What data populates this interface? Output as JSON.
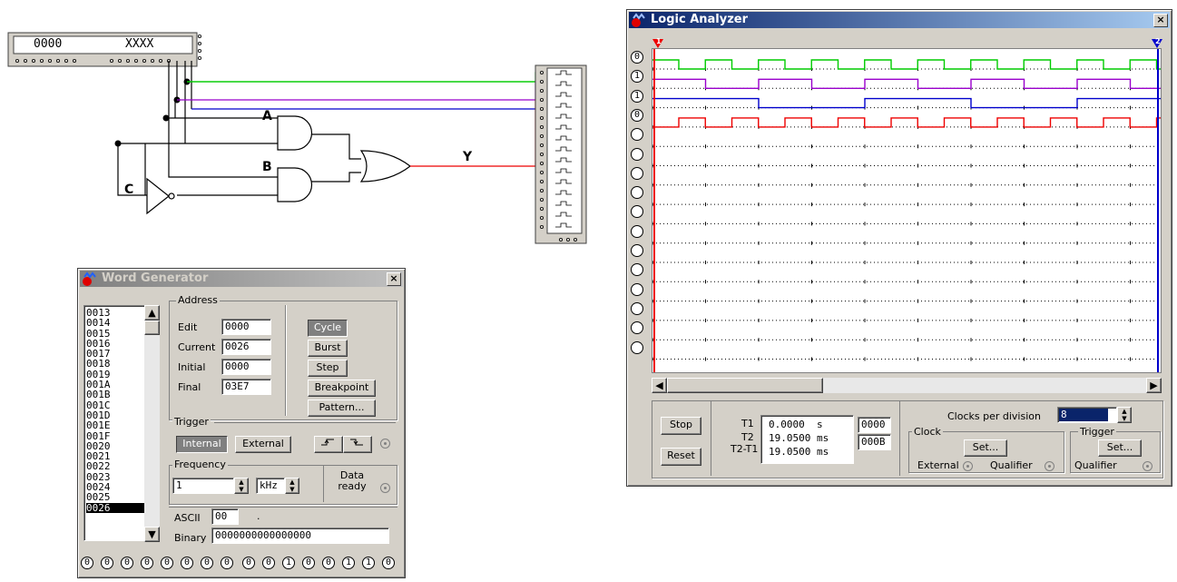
{
  "circuit": {
    "word_display": {
      "left": "0000",
      "right": "XXXX"
    },
    "labels": {
      "a": "A",
      "b": "B",
      "c": "C",
      "y": "Y"
    }
  },
  "word_generator": {
    "title": "Word Generator",
    "list": [
      "0013",
      "0014",
      "0015",
      "0016",
      "0017",
      "0018",
      "0019",
      "001A",
      "001B",
      "001C",
      "001D",
      "001E",
      "001F",
      "0020",
      "0021",
      "0022",
      "0023",
      "0024",
      "0025",
      "0026"
    ],
    "selected": "0026",
    "address": {
      "group": "Address",
      "edit_label": "Edit",
      "edit_value": "0000",
      "current_label": "Current",
      "current_value": "0026",
      "initial_label": "Initial",
      "initial_value": "0000",
      "final_label": "Final",
      "final_value": "03E7"
    },
    "buttons": {
      "cycle": "Cycle",
      "burst": "Burst",
      "step": "Step",
      "breakpoint": "Breakpoint",
      "pattern": "Pattern..."
    },
    "trigger": {
      "group": "Trigger",
      "internal": "Internal",
      "external": "External"
    },
    "frequency": {
      "group": "Frequency",
      "value": "1",
      "unit": "kHz",
      "data_ready": "Data ready"
    },
    "ascii_label": "ASCII",
    "ascii_value": "00",
    "ascii_dot": ".",
    "binary_label": "Binary",
    "binary_value": "0000000000000000",
    "bits": [
      "0",
      "0",
      "0",
      "0",
      "0",
      "0",
      "0",
      "0",
      "0",
      "0",
      "1",
      "0",
      "0",
      "1",
      "1",
      "0"
    ]
  },
  "logic_analyzer": {
    "title": "Logic Analyzer",
    "channels": [
      "0",
      "1",
      "1",
      "0",
      "",
      "",
      "",
      "",
      "",
      "",
      "",
      "",
      "",
      "",
      "",
      ""
    ],
    "cursor1": "1",
    "cursor2": "2",
    "buttons": {
      "stop": "Stop",
      "reset": "Reset",
      "set_clock": "Set...",
      "set_trigger": "Set..."
    },
    "t1_label": "T1",
    "t2_label": "T2",
    "t2t1_label": "T2-T1",
    "t1_value": "0.0000  s",
    "t2_value": "19.0500 ms",
    "t2t1_value": "19.0500 ms",
    "hex1": "0000",
    "hex2": "000B",
    "clocks_per_division_label": "Clocks per division",
    "clocks_per_division": "8",
    "clock_group": "Clock",
    "trigger_group": "Trigger",
    "external": "External",
    "qualifier1": "Qualifier",
    "qualifier2": "Qualifier"
  },
  "colors": {
    "ch0": "#00cc00",
    "ch1": "#9900cc",
    "ch2": "#0000cc",
    "ch3": "#ee0000",
    "title_active": "#0a246a"
  }
}
